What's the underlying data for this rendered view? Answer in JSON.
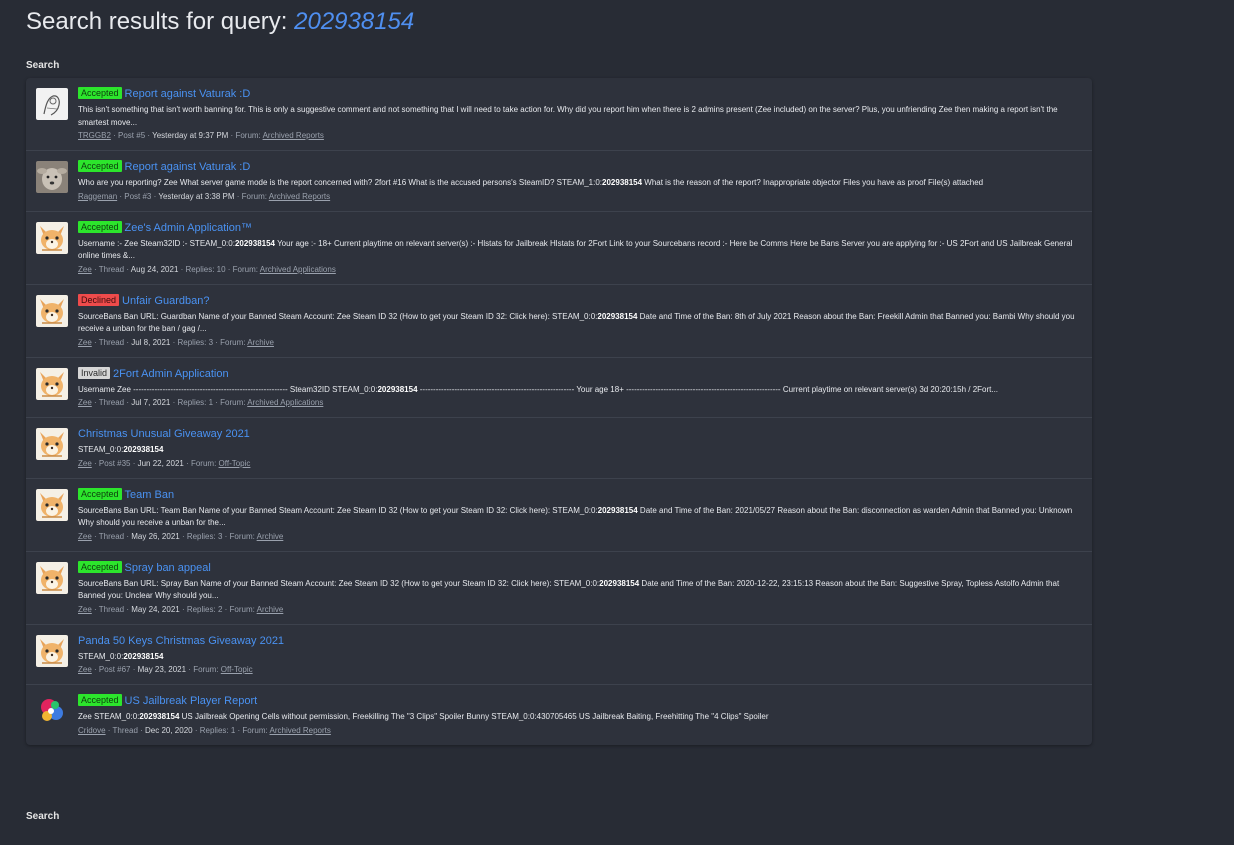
{
  "header": {
    "title_prefix": "Search results for query: ",
    "query": "202938154"
  },
  "breadcrumb_top": "Search",
  "breadcrumb_bottom": "Search",
  "colors": {
    "background": "#282c35",
    "panel": "#2e323c",
    "link": "#4a92f2",
    "accepted": "#2ce52c",
    "declined": "#ef4b4b",
    "invalid": "#d6d6d6"
  },
  "results": [
    {
      "avatar": "sketch-avatar",
      "label": "Accepted",
      "label_type": "accepted",
      "title": "Report against Vaturak :D",
      "snippet_before": "This isn't something that isn't worth banning for. This is only a suggestive comment and not something that I will need to take action for. Why did you report him when there is 2 admins present (Zee included) on the server? Plus, you unfriending Zee then making a report isn't the smartest move...",
      "snippet_bold": "",
      "snippet_after": "",
      "author": "TRGGB2",
      "type": "Post #5",
      "date": "Yesterday at 9:37 PM",
      "replies": "",
      "forum_prefix": "Forum:",
      "forum": "Archived Reports"
    },
    {
      "avatar": "dog-avatar",
      "label": "Accepted",
      "label_type": "accepted",
      "title": "Report against Vaturak :D",
      "snippet_before": "Who are you reporting? Zee What server game mode is the report concerned with? 2fort #16 What is the accused persons's SteamID? STEAM_1:0:",
      "snippet_bold": "202938154",
      "snippet_after": " What is the reason of the report? Inappropriate objector Files you have as proof File(s) attached",
      "author": "Raggeman",
      "type": "Post #3",
      "date": "Yesterday at 3:38 PM",
      "replies": "",
      "forum_prefix": "Forum:",
      "forum": "Archived Reports"
    },
    {
      "avatar": "fox-avatar",
      "label": "Accepted",
      "label_type": "accepted",
      "title": "Zee's Admin Application™",
      "snippet_before": "Username :- Zee Steam32ID :- STEAM_0:0:",
      "snippet_bold": "202938154",
      "snippet_after": " Your age :- 18+ Current playtime on relevant server(s) :- Hlstats for Jailbreak Hlstats for 2Fort Link to your Sourcebans record :- Here be Comms Here be Bans Server you are applying for :- US 2Fort and US Jailbreak General online times &...",
      "author": "Zee",
      "type": "Thread",
      "date": "Aug 24, 2021",
      "replies": "Replies: 10",
      "forum_prefix": "Forum:",
      "forum": "Archived Applications"
    },
    {
      "avatar": "fox-avatar",
      "label": "Declined",
      "label_type": "declined",
      "title": "Unfair Guardban?",
      "snippet_before": "SourceBans Ban URL: Guardban Name of your Banned Steam Account: Zee Steam ID 32 (How to get your Steam ID 32: Click here): STEAM_0:0:",
      "snippet_bold": "202938154",
      "snippet_after": " Date and Time of the Ban: 8th of July 2021 Reason about the Ban: Freekill Admin that Banned you: Bambi Why should you receive a unban for the ban / gag /...",
      "author": "Zee",
      "type": "Thread",
      "date": "Jul 8, 2021",
      "replies": "Replies: 3",
      "forum_prefix": "Forum:",
      "forum": "Archive"
    },
    {
      "avatar": "fox-avatar",
      "label": "Invalid",
      "label_type": "invalid",
      "title": "2Fort Admin Application",
      "snippet_before": "Username Zee ---------------------------------------------------------- Steam32ID STEAM_0:0:",
      "snippet_bold": "202938154",
      "snippet_after": " ---------------------------------------------------------- Your age 18+ ---------------------------------------------------------- Current playtime on relevant server(s) 3d 20:20:15h / 2Fort...",
      "author": "Zee",
      "type": "Thread",
      "date": "Jul 7, 2021",
      "replies": "Replies: 1",
      "forum_prefix": "Forum:",
      "forum": "Archived Applications"
    },
    {
      "avatar": "fox-avatar",
      "label": "",
      "label_type": "",
      "title": "Christmas Unusual Giveaway 2021",
      "snippet_before": "STEAM_0:0:",
      "snippet_bold": "202938154",
      "snippet_after": "",
      "author": "Zee",
      "type": "Post #35",
      "date": "Jun 22, 2021",
      "replies": "",
      "forum_prefix": "Forum:",
      "forum": "Off-Topic"
    },
    {
      "avatar": "fox-avatar",
      "label": "Accepted",
      "label_type": "accepted",
      "title": "Team Ban",
      "snippet_before": "SourceBans Ban URL: Team Ban Name of your Banned Steam Account: Zee Steam ID 32 (How to get your Steam ID 32: Click here): STEAM_0:0:",
      "snippet_bold": "202938154",
      "snippet_after": " Date and Time of the Ban: 2021/05/27 Reason about the Ban: disconnection as warden Admin that Banned you: Unknown Why should you receive a unban for the...",
      "author": "Zee",
      "type": "Thread",
      "date": "May 26, 2021",
      "replies": "Replies: 3",
      "forum_prefix": "Forum:",
      "forum": "Archive"
    },
    {
      "avatar": "fox-avatar",
      "label": "Accepted",
      "label_type": "accepted",
      "title": "Spray ban appeal",
      "snippet_before": "SourceBans Ban URL: Spray Ban Name of your Banned Steam Account: Zee Steam ID 32 (How to get your Steam ID 32: Click here): STEAM_0:0:",
      "snippet_bold": "202938154",
      "snippet_after": " Date and Time of the Ban: 2020-12-22, 23:15:13 Reason about the Ban: Suggestive Spray, Topless Astolfo Admin that Banned you: Unclear Why should you...",
      "author": "Zee",
      "type": "Thread",
      "date": "May 24, 2021",
      "replies": "Replies: 2",
      "forum_prefix": "Forum:",
      "forum": "Archive"
    },
    {
      "avatar": "fox-avatar",
      "label": "",
      "label_type": "",
      "title": "Panda 50 Keys Christmas Giveaway 2021",
      "snippet_before": "STEAM_0:0:",
      "snippet_bold": "202938154",
      "snippet_after": "",
      "author": "Zee",
      "type": "Post #67",
      "date": "May 23, 2021",
      "replies": "",
      "forum_prefix": "Forum:",
      "forum": "Off-Topic"
    },
    {
      "avatar": "colorful-avatar",
      "label": "Accepted",
      "label_type": "accepted",
      "title": "US Jailbreak Player Report",
      "snippet_before": "Zee STEAM_0:0:",
      "snippet_bold": "202938154",
      "snippet_after": " US Jailbreak Opening Cells without permission, Freekilling The \"3 Clips\" Spoiler Bunny STEAM_0:0:430705465 US Jailbreak Baiting, Freehitting The \"4 Clips\" Spoiler",
      "author": "Cridove",
      "type": "Thread",
      "date": "Dec 20, 2020",
      "replies": "Replies: 1",
      "forum_prefix": "Forum:",
      "forum": "Archived Reports"
    }
  ]
}
